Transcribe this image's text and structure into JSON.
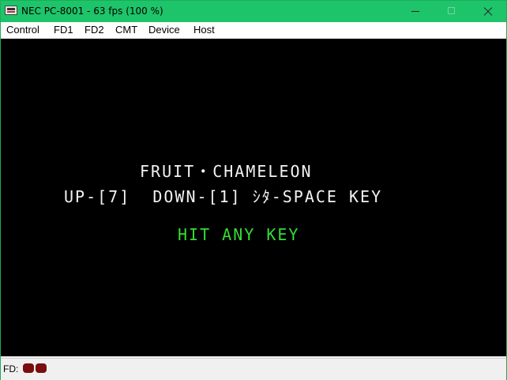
{
  "window": {
    "title": "NEC PC-8001 - 63 fps (100 %)"
  },
  "menu": [
    "Control",
    "FD1",
    "FD2",
    "CMT",
    "Device",
    "Host"
  ],
  "screen": {
    "title_line": "FRUIT・CHAMELEON",
    "controls_line": "UP-[7]  DOWN-[1] ｼﾀ-SPACE KEY",
    "prompt_line": "HIT ANY KEY",
    "colors": {
      "background": "#000000",
      "text": "#f2f2f2",
      "prompt": "#33dd33"
    }
  },
  "status": {
    "fd_label": "FD:",
    "drives": [
      {
        "drive": "FD1",
        "led_color": "#7a0d0d"
      },
      {
        "drive": "FD2",
        "led_color": "#7a0d0d"
      }
    ]
  },
  "theme": {
    "titlebar": "#1ec46a"
  }
}
